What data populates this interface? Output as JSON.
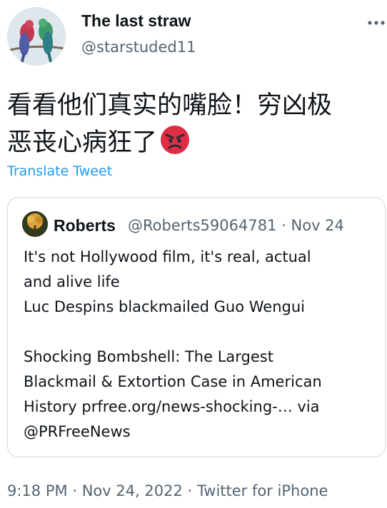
{
  "author": {
    "display_name": "The last straw",
    "handle": "@starstuded11",
    "avatar_icon": "parrots-avatar"
  },
  "tweet": {
    "text_lines": [
      "看看他们真实的嘴脸！穷凶极",
      "恶丧心病狂了"
    ],
    "emoji": "angry-face-emoji",
    "translate_label": "Translate Tweet"
  },
  "quoted_tweet": {
    "author_name": "Roberts",
    "author_handle": "@Roberts59064781",
    "separator": "·",
    "date": "Nov 24",
    "text_lines": [
      "It's not Hollywood film, it's real, actual",
      "and alive life",
      "Luc Despins blackmailed Guo Wengui",
      "",
      "Shocking Bombshell: The Largest",
      "Blackmail & Extortion Case in American",
      "History prfree.org/news-shocking-… via",
      "@PRFreeNews"
    ]
  },
  "footer": {
    "time": "9:18 PM",
    "date": "Nov 24, 2022",
    "source": "Twitter for iPhone",
    "separator": "·"
  },
  "colors": {
    "text_primary": "#0f1419",
    "text_secondary": "#536471",
    "link": "#1d9bf0",
    "border": "#cfd9de",
    "emoji_red": "#e0245e"
  }
}
